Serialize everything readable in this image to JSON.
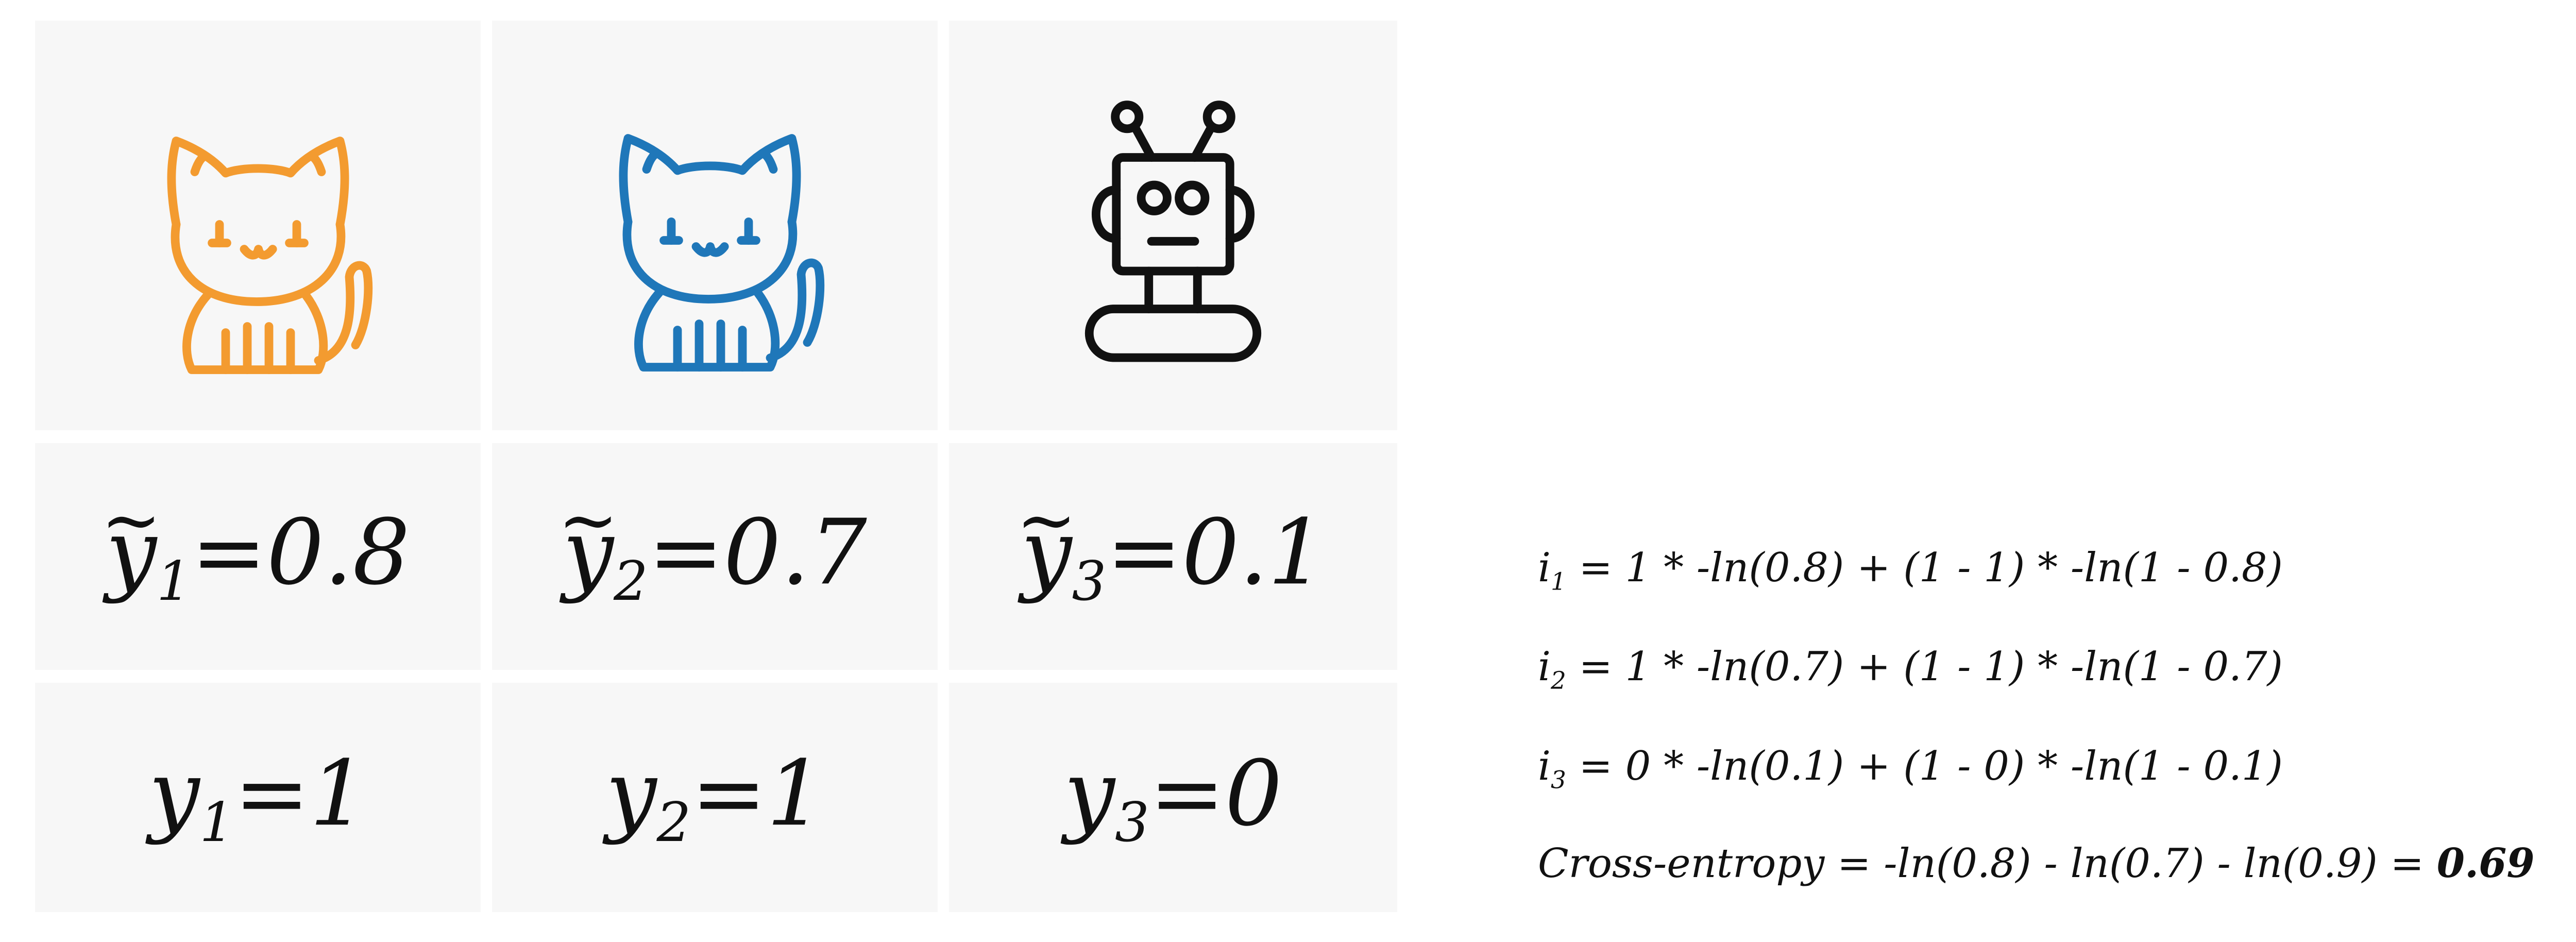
{
  "columns": [
    {
      "icon": "orange-cat-icon",
      "icon_color": "#f39b30",
      "pred": {
        "var": "y",
        "sub": "1",
        "value": "=0.8"
      },
      "true": {
        "var": "y",
        "sub": "1",
        "value": "=1"
      }
    },
    {
      "icon": "blue-cat-icon",
      "icon_color": "#1f77b9",
      "pred": {
        "var": "y",
        "sub": "2",
        "value": "=0.7"
      },
      "true": {
        "var": "y",
        "sub": "2",
        "value": "=1"
      }
    },
    {
      "icon": "robot-icon",
      "icon_color": "#111111",
      "pred": {
        "var": "y",
        "sub": "3",
        "value": "=0.1"
      },
      "true": {
        "var": "y",
        "sub": "3",
        "value": "=0"
      }
    }
  ],
  "tilde": "~",
  "equations": [
    {
      "var": "i",
      "sub": "1",
      "expr": " = 1 * -ln(0.8) + (1 - 1) * -ln(1 - 0.8)"
    },
    {
      "var": "i",
      "sub": "2",
      "expr": " = 1 * -ln(0.7) + (1 - 1) * -ln(1 - 0.7)"
    },
    {
      "var": "i",
      "sub": "3",
      "expr": " = 0 * -ln(0.1) + (1 - 0) * -ln(1 - 0.1)"
    }
  ],
  "cross_entropy": {
    "expr": "Cross-entropy = -ln(0.8) - ln(0.7) - ln(0.9) = ",
    "result": "0.69"
  }
}
